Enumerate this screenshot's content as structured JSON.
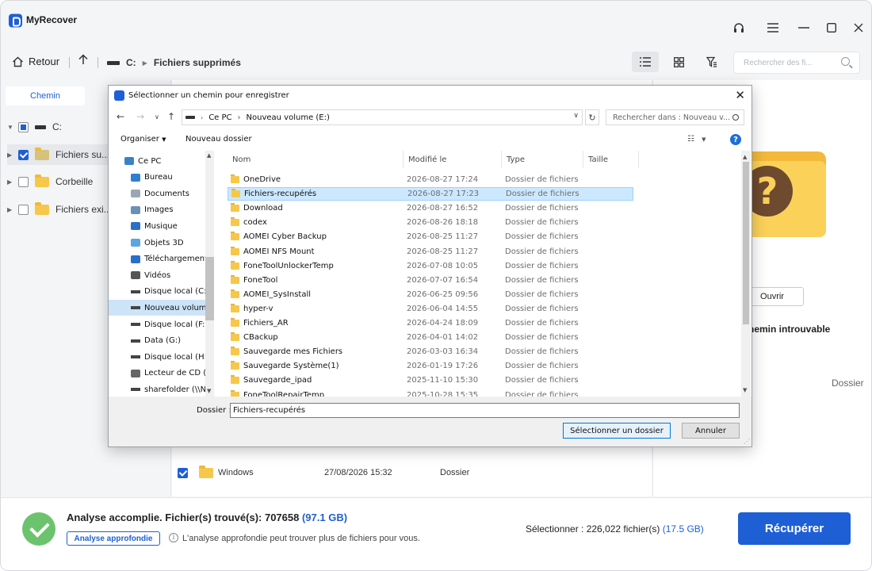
{
  "app": {
    "title": "MyRecover",
    "window_controls": [
      "headset-icon",
      "menu-icon",
      "minimize-icon",
      "maximize-icon",
      "close-icon"
    ]
  },
  "toolbar": {
    "back_label": "Retour",
    "drive": "C:",
    "current_folder": "Fichiers supprimés",
    "search_placeholder": "Rechercher des fi..."
  },
  "left_panel": {
    "tab_label": "Chemin",
    "tree": [
      {
        "label": "C:",
        "state": "partial",
        "level": 0
      },
      {
        "label": "Fichiers su...",
        "state": "checked",
        "level": 1
      },
      {
        "label": "Corbeille",
        "state": "unchecked",
        "level": 1
      },
      {
        "label": "Fichiers exi...",
        "state": "unchecked",
        "level": 1
      }
    ]
  },
  "main": {
    "visible_row": {
      "name": "Windows",
      "date": "27/08/2026 15:32",
      "type": "Dossier"
    }
  },
  "right_panel": {
    "open_label": "Ouvrir",
    "not_found": "hemin introuvable",
    "type_label": "Dossier"
  },
  "bottom": {
    "status_prefix": "Analyse accomplie. Fichier(s) trouvé(s): 707658 ",
    "status_size": "(97.1 GB)",
    "deep_scan_label": "Analyse approfondie",
    "info_text": "L'analyse approfondie peut trouver plus de fichiers pour vous.",
    "selection_prefix": "Sélectionner : 226,022 fichier(s) ",
    "selection_size": "(17.5 GB)",
    "recover_label": "Récupérer"
  },
  "dialog": {
    "title": "Sélectionner un chemin pour enregistrer",
    "address": [
      "Ce PC",
      "Nouveau volume (E:)"
    ],
    "search_placeholder": "Rechercher dans : Nouveau v...",
    "organize_label": "Organiser",
    "new_folder_label": "Nouveau dossier",
    "nav_items": [
      {
        "label": "Ce PC",
        "icon": "pc-icon"
      },
      {
        "label": "Bureau",
        "icon": "desktop-icon"
      },
      {
        "label": "Documents",
        "icon": "documents-icon"
      },
      {
        "label": "Images",
        "icon": "images-icon"
      },
      {
        "label": "Musique",
        "icon": "music-icon"
      },
      {
        "label": "Objets 3D",
        "icon": "3d-objects-icon"
      },
      {
        "label": "Téléchargements",
        "icon": "downloads-icon"
      },
      {
        "label": "Vidéos",
        "icon": "videos-icon"
      },
      {
        "label": "Disque local (C:)",
        "icon": "drive-icon"
      },
      {
        "label": "Nouveau volum",
        "icon": "drive-icon",
        "selected": true
      },
      {
        "label": "Disque local (F:)",
        "icon": "drive-icon"
      },
      {
        "label": "Data (G:)",
        "icon": "drive-icon"
      },
      {
        "label": "Disque local (H:)",
        "icon": "drive-icon"
      },
      {
        "label": "Lecteur de CD (I:",
        "icon": "cd-icon"
      },
      {
        "label": "sharefolder (\\\\N",
        "icon": "network-drive-icon"
      }
    ],
    "columns": [
      "Nom",
      "Modifié le",
      "Type",
      "Taille"
    ],
    "files": [
      {
        "name": "OneDrive",
        "date": "2026-08-27 17:24",
        "type": "Dossier de fichiers"
      },
      {
        "name": "Fichiers-recupérés",
        "date": "2026-08-27 17:23",
        "type": "Dossier de fichiers",
        "selected": true
      },
      {
        "name": "Download",
        "date": "2026-08-27 16:52",
        "type": "Dossier de fichiers"
      },
      {
        "name": "codex",
        "date": "2026-08-26 18:18",
        "type": "Dossier de fichiers"
      },
      {
        "name": "AOMEI Cyber Backup",
        "date": "2026-08-25 11:27",
        "type": "Dossier de fichiers"
      },
      {
        "name": "AOMEI NFS Mount",
        "date": "2026-08-25 11:27",
        "type": "Dossier de fichiers"
      },
      {
        "name": "FoneToolUnlockerTemp",
        "date": "2026-07-08 10:05",
        "type": "Dossier de fichiers"
      },
      {
        "name": "FoneTool",
        "date": "2026-07-07 16:54",
        "type": "Dossier de fichiers"
      },
      {
        "name": "AOMEI_SysInstall",
        "date": "2026-06-25 09:56",
        "type": "Dossier de fichiers"
      },
      {
        "name": "hyper-v",
        "date": "2026-06-04 14:55",
        "type": "Dossier de fichiers"
      },
      {
        "name": "Fichiers_AR",
        "date": "2026-04-24 18:09",
        "type": "Dossier de fichiers"
      },
      {
        "name": "CBackup",
        "date": "2026-04-01 14:02",
        "type": "Dossier de fichiers"
      },
      {
        "name": "Sauvegarde mes Fichiers",
        "date": "2026-03-03 16:34",
        "type": "Dossier de fichiers"
      },
      {
        "name": "Sauvegarde Système(1)",
        "date": "2026-01-19 17:26",
        "type": "Dossier de fichiers"
      },
      {
        "name": "Sauvegarde_ipad",
        "date": "2025-11-10 15:30",
        "type": "Dossier de fichiers"
      },
      {
        "name": "FoneToolRepairTemp",
        "date": "2025-10-28 15:35",
        "type": "Dossier de fichiers"
      }
    ],
    "folder_label": "Dossier :",
    "folder_value": "Fichiers-recupérés",
    "select_label": "Sélectionner un dossier",
    "cancel_label": "Annuler"
  }
}
